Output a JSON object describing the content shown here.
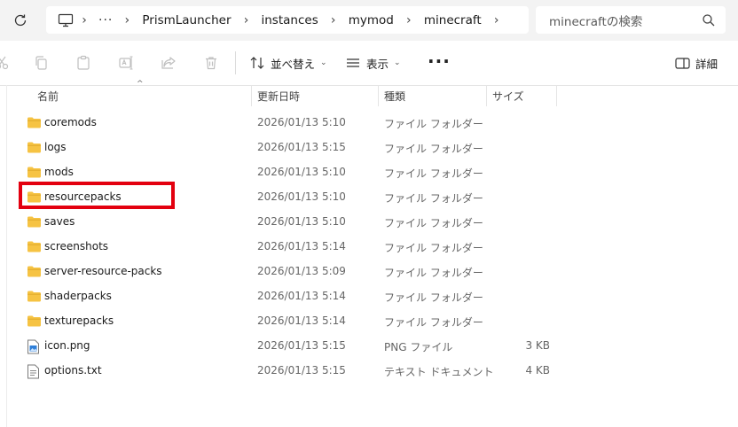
{
  "address_bar": {
    "refresh_icon": "refresh-icon",
    "overflow": "···",
    "breadcrumbs": [
      "PrismLauncher",
      "instances",
      "mymod",
      "minecraft"
    ],
    "search_placeholder": "minecraftの検索"
  },
  "toolbar": {
    "sort_label": "並べ替え",
    "view_label": "表示",
    "more_label": "···",
    "details_label": "詳細"
  },
  "columns": {
    "name": "名前",
    "date": "更新日時",
    "type": "種類",
    "size": "サイズ"
  },
  "files": [
    {
      "name": "coremods",
      "date": "2026/01/13 5:10",
      "type": "ファイル フォルダー",
      "size": "",
      "icon": "folder"
    },
    {
      "name": "logs",
      "date": "2026/01/13 5:15",
      "type": "ファイル フォルダー",
      "size": "",
      "icon": "folder"
    },
    {
      "name": "mods",
      "date": "2026/01/13 5:10",
      "type": "ファイル フォルダー",
      "size": "",
      "icon": "folder"
    },
    {
      "name": "resourcepacks",
      "date": "2026/01/13 5:10",
      "type": "ファイル フォルダー",
      "size": "",
      "icon": "folder"
    },
    {
      "name": "saves",
      "date": "2026/01/13 5:10",
      "type": "ファイル フォルダー",
      "size": "",
      "icon": "folder"
    },
    {
      "name": "screenshots",
      "date": "2026/01/13 5:14",
      "type": "ファイル フォルダー",
      "size": "",
      "icon": "folder"
    },
    {
      "name": "server-resource-packs",
      "date": "2026/01/13 5:09",
      "type": "ファイル フォルダー",
      "size": "",
      "icon": "folder"
    },
    {
      "name": "shaderpacks",
      "date": "2026/01/13 5:14",
      "type": "ファイル フォルダー",
      "size": "",
      "icon": "folder"
    },
    {
      "name": "texturepacks",
      "date": "2026/01/13 5:14",
      "type": "ファイル フォルダー",
      "size": "",
      "icon": "folder"
    },
    {
      "name": "icon.png",
      "date": "2026/01/13 5:15",
      "type": "PNG ファイル",
      "size": "3 KB",
      "icon": "image"
    },
    {
      "name": "options.txt",
      "date": "2026/01/13 5:15",
      "type": "テキスト ドキュメント",
      "size": "4 KB",
      "icon": "text"
    }
  ],
  "highlighted_item": "resourcepacks",
  "colors": {
    "highlight": "#e3000f",
    "folder": "#f6c343",
    "addressbar_bg": "#f3f3f3"
  }
}
